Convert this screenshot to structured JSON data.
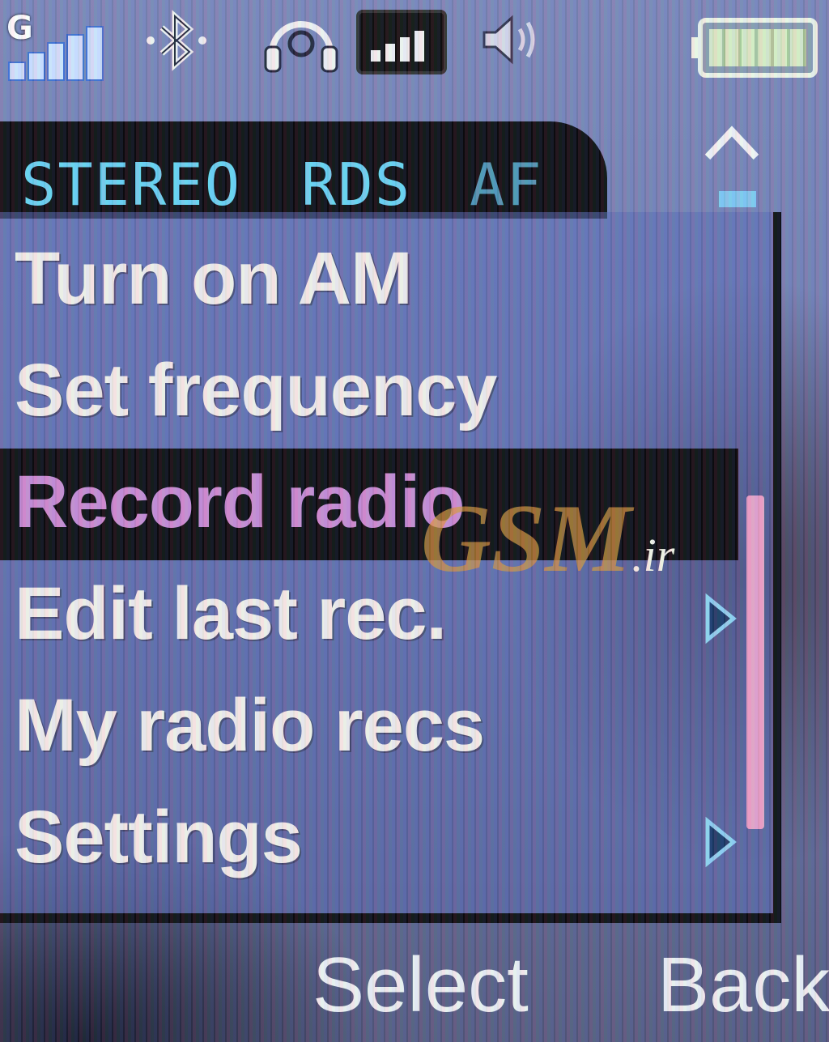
{
  "status_bar": {
    "gprs_label": "G",
    "icons": [
      "signal-strength-icon",
      "bluetooth-icon",
      "headset-icon",
      "network-strength-icon",
      "volume-icon",
      "battery-icon"
    ]
  },
  "radio_tab": {
    "flags": {
      "stereo": "STEREO",
      "rds": "RDS",
      "af": "AF"
    }
  },
  "menu": {
    "items": [
      {
        "label": "Turn on AM",
        "has_submenu": false,
        "selected": false
      },
      {
        "label": "Set frequency",
        "has_submenu": false,
        "selected": false
      },
      {
        "label": "Record radio",
        "has_submenu": false,
        "selected": true
      },
      {
        "label": "Edit last rec.",
        "has_submenu": true,
        "selected": false
      },
      {
        "label": "My radio recs",
        "has_submenu": false,
        "selected": false
      },
      {
        "label": "Settings",
        "has_submenu": true,
        "selected": false
      }
    ]
  },
  "watermark": {
    "text": "GSM",
    "suffix": ".ir"
  },
  "softkeys": {
    "left": "Select",
    "right": "Back"
  },
  "colors": {
    "flag_active": "#68d2f2",
    "flag_dim": "#4e96b4",
    "selected_text": "#c88ad2",
    "menu_text": "#f3eeea",
    "scroll_thumb": "#e7a0c8"
  }
}
